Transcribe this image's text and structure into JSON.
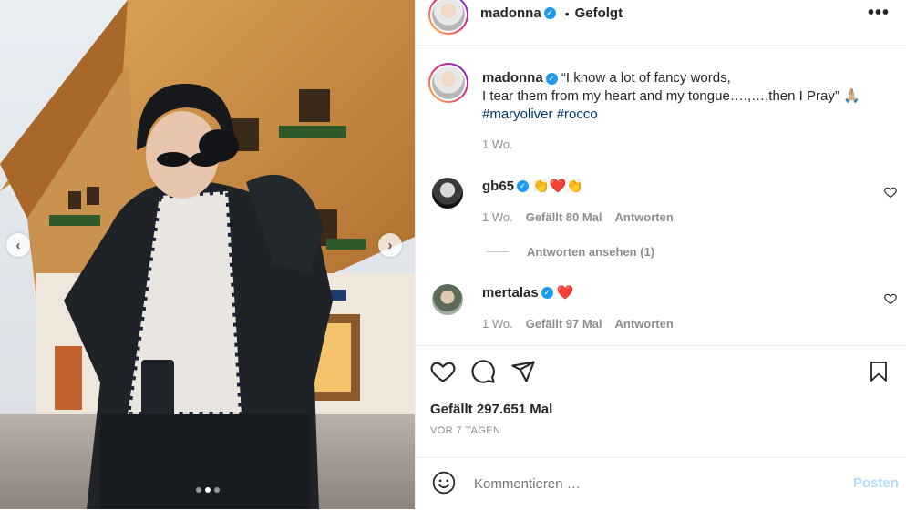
{
  "colors": {
    "accent_link": "#00376b",
    "verified": "#1d9bf0",
    "post_disabled": "#b3dbff",
    "heart": "#ed4956"
  },
  "header": {
    "username": "madonna",
    "separator": "•",
    "follow_label": "Gefolgt",
    "more_icon": "more-horizontal-icon"
  },
  "carousel": {
    "total_images": 3,
    "active_index": 1,
    "prev_icon": "chevron-left-icon",
    "next_icon": "chevron-right-icon"
  },
  "caption": {
    "username": "madonna",
    "text_line1": "“I know a lot of fancy words,",
    "text_line2": "I tear them from my heart and my tongue….,…,then I Pray” 🙏🏼",
    "hashtag1": "#maryoliver",
    "hashtag2": "#rocco",
    "time": "1 Wo."
  },
  "comments": [
    {
      "username": "gb65",
      "text": "👏❤️👏",
      "time": "1 Wo.",
      "likes": "Gefällt 80 Mal",
      "reply": "Antworten"
    },
    {
      "username": "mertalas",
      "text": "❤️",
      "time": "1 Wo.",
      "likes": "Gefällt 97 Mal",
      "reply": "Antworten"
    }
  ],
  "view_replies": "Antworten ansehen (1)",
  "actions": {
    "like_icon": "heart-icon",
    "comment_icon": "comment-icon",
    "share_icon": "send-icon",
    "save_icon": "bookmark-icon"
  },
  "likes_count": "Gefällt 297.651 Mal",
  "posted_ago": "VOR 7 TAGEN",
  "comment_input": {
    "placeholder": "Kommentieren …",
    "post_label": "Posten",
    "emoji_icon": "smiley-icon"
  }
}
